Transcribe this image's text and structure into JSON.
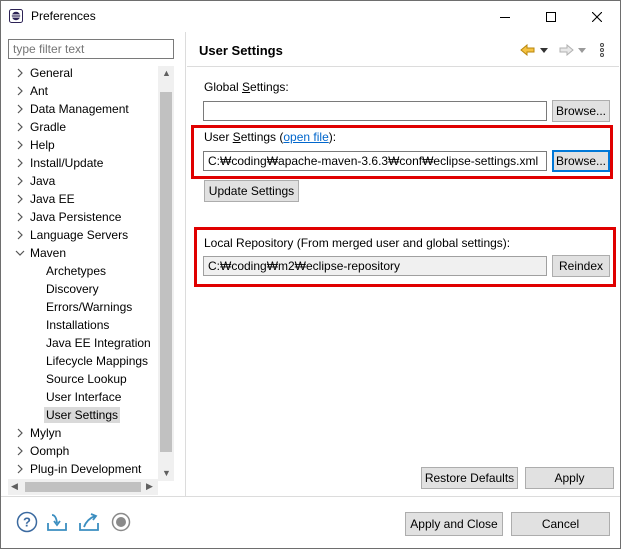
{
  "window": {
    "title": "Preferences",
    "buttons": [
      "minimize",
      "maximize",
      "close"
    ]
  },
  "filter": {
    "placeholder": "type filter text"
  },
  "tree": {
    "items": [
      {
        "label": "General",
        "level": 0,
        "expanded": false
      },
      {
        "label": "Ant",
        "level": 0,
        "expanded": false
      },
      {
        "label": "Data Management",
        "level": 0,
        "expanded": false
      },
      {
        "label": "Gradle",
        "level": 0,
        "expanded": false
      },
      {
        "label": "Help",
        "level": 0,
        "expanded": false
      },
      {
        "label": "Install/Update",
        "level": 0,
        "expanded": false
      },
      {
        "label": "Java",
        "level": 0,
        "expanded": false
      },
      {
        "label": "Java EE",
        "level": 0,
        "expanded": false
      },
      {
        "label": "Java Persistence",
        "level": 0,
        "expanded": false
      },
      {
        "label": "Language Servers",
        "level": 0,
        "expanded": false
      },
      {
        "label": "Maven",
        "level": 0,
        "expanded": true
      },
      {
        "label": "Archetypes",
        "level": 1
      },
      {
        "label": "Discovery",
        "level": 1
      },
      {
        "label": "Errors/Warnings",
        "level": 1
      },
      {
        "label": "Installations",
        "level": 1
      },
      {
        "label": "Java EE Integration",
        "level": 1
      },
      {
        "label": "Lifecycle Mappings",
        "level": 1
      },
      {
        "label": "Source Lookup",
        "level": 1
      },
      {
        "label": "User Interface",
        "level": 1
      },
      {
        "label": "User Settings",
        "level": 1,
        "selected": true
      },
      {
        "label": "Mylyn",
        "level": 0,
        "expanded": false
      },
      {
        "label": "Oomph",
        "level": 0,
        "expanded": false
      },
      {
        "label": "Plug-in Development",
        "level": 0,
        "expanded": false
      }
    ]
  },
  "page": {
    "title": "User Settings",
    "global_settings_label_pre": "Global ",
    "global_settings_label_mn": "S",
    "global_settings_label_post": "ettings:",
    "global_settings_value": "",
    "user_settings_label_pre": "User ",
    "user_settings_label_mn": "S",
    "user_settings_label_post": "ettings (",
    "open_file_link": "open file",
    "user_settings_label_end": "):",
    "user_settings_value": "C:₩coding₩apache-maven-3.6.3₩conf₩eclipse-settings.xml",
    "browse_label": "Browse...",
    "update_settings_label": "Update Settings",
    "local_repo_label": "Local Repository (From merged user and global settings):",
    "local_repo_value": "C:₩coding₩m2₩eclipse-repository",
    "reindex_label": "Reindex",
    "restore_defaults_label": "Restore Defaults",
    "apply_label": "Apply"
  },
  "footer": {
    "apply_and_close_label": "Apply and Close",
    "cancel_label": "Cancel",
    "icons": [
      "help-icon",
      "import-icon",
      "export-icon",
      "record-icon"
    ]
  },
  "colors": {
    "highlight_border": "#e00000",
    "link": "#0066cc",
    "selection": "#d9d9d9",
    "focus": "#0078d7"
  }
}
